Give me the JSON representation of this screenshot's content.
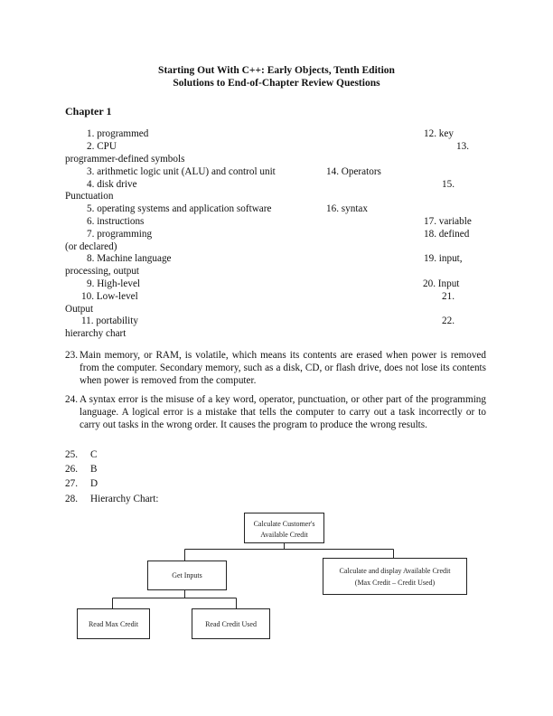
{
  "header": {
    "title_line1": "Starting Out With C++: Early Objects, Tenth Edition",
    "title_line2": "Solutions to End-of-Chapter Review Questions"
  },
  "chapter": "Chapter 1",
  "list_lines": [
    {
      "left": "1. programmed",
      "right": "12. key"
    },
    {
      "left": "2. CPU",
      "right": "13."
    },
    {
      "left": "programmer-defined symbols",
      "right": ""
    },
    {
      "left": "3. arithmetic logic unit (ALU) and control unit",
      "mid": "14. Operators"
    },
    {
      "left": "4. disk drive",
      "right": "15."
    },
    {
      "left": "Punctuation",
      "right": ""
    },
    {
      "left": "5. operating systems and application software",
      "mid": "16. syntax"
    },
    {
      "left": "6. instructions",
      "right": "17. variable"
    },
    {
      "left": "7. programming",
      "right": "18. defined"
    },
    {
      "left": "(or declared)",
      "right": ""
    },
    {
      "left": "8. Machine language",
      "right": "19. input,"
    },
    {
      "left": "processing, output",
      "right": ""
    },
    {
      "left": "9. High-level",
      "right": "20. Input"
    },
    {
      "left": "10. Low-level",
      "right": "21."
    },
    {
      "left": "Output",
      "right": ""
    },
    {
      "left": "11. portability",
      "right": "22."
    },
    {
      "left": "hierarchy chart",
      "right": ""
    }
  ],
  "answers": {
    "q23": {
      "num": "23.",
      "text": "Main memory, or RAM, is volatile, which means its contents are erased when power is removed from the computer. Secondary memory, such as a disk, CD, or flash drive, does not lose its contents when power is removed from the computer."
    },
    "q24": {
      "num": "24.",
      "text": "A syntax error is the misuse of a key word, operator, punctuation, or other part of the programming language. A logical error is a mistake that tells the computer to carry out a task incorrectly or to carry out tasks in the wrong order.  It causes the program to produce the wrong results."
    },
    "q25": {
      "num": "25.",
      "text": "C"
    },
    "q26": {
      "num": "26.",
      "text": "B"
    },
    "q27": {
      "num": "27.",
      "text": "D"
    },
    "q28": {
      "num": "28.",
      "text": "Hierarchy Chart:"
    }
  },
  "hierarchy_chart": {
    "root": {
      "line1": "Calculate Customer's",
      "line2": "Available Credit"
    },
    "get_inputs": "Get Inputs",
    "calc_display": {
      "line1": "Calculate and display Available Credit",
      "line2": "(Max Credit – Credit Used)"
    },
    "read_max": "Read Max Credit",
    "read_used": "Read Credit Used"
  }
}
